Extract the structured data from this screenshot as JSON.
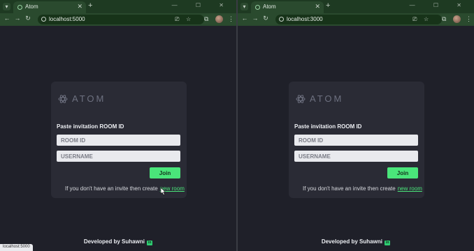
{
  "left": {
    "tab": {
      "title": "Atom",
      "close": "✕",
      "new": "+"
    },
    "menu": "▾",
    "controls": "— ☐ ✕",
    "url": "localhost:5000",
    "status_url": "localhost:5000",
    "card": {
      "logo": "ATOM",
      "heading": "Paste invitation ROOM ID",
      "room_placeholder": "ROOM ID",
      "user_placeholder": "USERNAME",
      "join": "Join",
      "hint": "If you don't have an invite then create",
      "link": "new room"
    },
    "footer": "Developed by Suhawni",
    "footer_badge": "in"
  },
  "right": {
    "tab": {
      "title": "Atom",
      "close": "✕",
      "new": "+"
    },
    "menu": "▾",
    "controls": "— ☐ ✕",
    "url": "localhost:3000",
    "card": {
      "logo": "ATOM",
      "heading": "Paste invitation ROOM ID",
      "room_placeholder": "ROOM ID",
      "user_placeholder": "USERNAME",
      "join": "Join",
      "hint": "If you don't have an invite then create",
      "link": "new room"
    },
    "footer": "Developed by Suhawni",
    "footer_badge": "in"
  },
  "icons": {
    "back": "←",
    "forward": "→",
    "reload": "↻",
    "cast": "⎚",
    "star": "☆",
    "extensions": "⧉",
    "more": "⋮"
  },
  "colors": {
    "accent": "#4ae57a",
    "page_bg": "#1f2029",
    "card_bg": "#2a2b35",
    "chrome": "#2a4a2e"
  }
}
